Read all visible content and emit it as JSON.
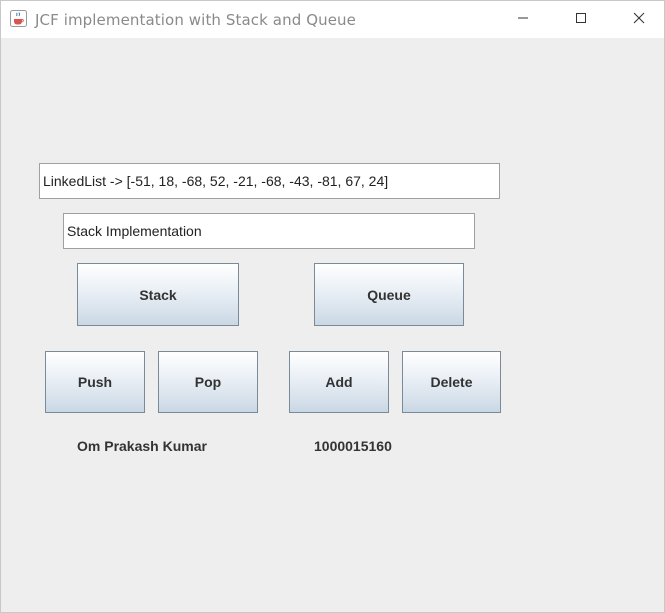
{
  "window": {
    "title": "JCF implementation with Stack and Queue",
    "icon": "java-coffee-cup-icon",
    "controls": [
      "minimize-icon",
      "maximize-icon",
      "close-icon"
    ]
  },
  "fields": {
    "linked_list_value": "LinkedList -> [-51, 18, -68, 52, -21, -68, -43, -81, 67, 24]",
    "implementation_value": "Stack Implementation"
  },
  "buttons": {
    "stack": "Stack",
    "queue": "Queue",
    "push": "Push",
    "pop": "Pop",
    "add": "Add",
    "delete": "Delete"
  },
  "labels": {
    "name": "Om Prakash Kumar",
    "id": "1000015160"
  },
  "colors": {
    "window_background": "#eeeeee",
    "title_text": "#8a8a8a",
    "button_gradient_bottom": "#c9d7e4",
    "button_border": "#7a8a99",
    "label_text": "#333333"
  }
}
